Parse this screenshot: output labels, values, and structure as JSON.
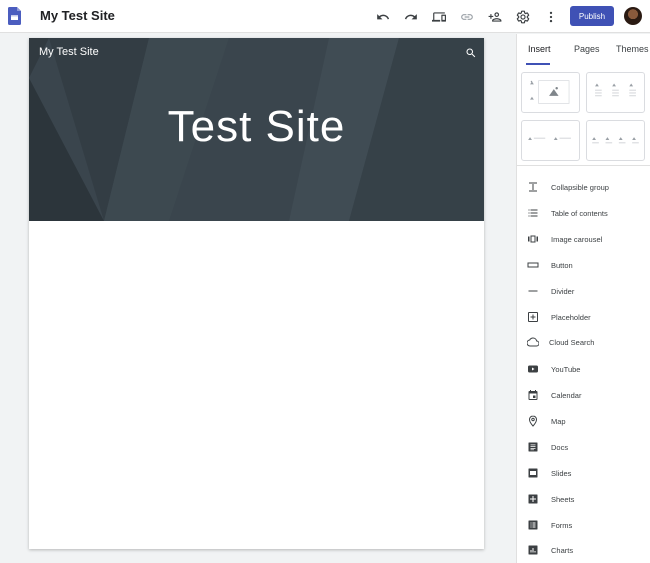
{
  "app": {
    "title": "My Test Site",
    "publish_label": "Publish"
  },
  "toolbar": {
    "icons": [
      "undo-icon",
      "redo-icon",
      "preview-icon",
      "link-icon",
      "share-icon",
      "settings-icon",
      "more-icon"
    ]
  },
  "site": {
    "header_name": "My Test Site",
    "hero_title": "Test Site"
  },
  "sidebar": {
    "tabs": [
      {
        "label": "Insert"
      },
      {
        "label": "Pages"
      },
      {
        "label": "Themes"
      }
    ],
    "items": [
      {
        "label": "Collapsible group",
        "icon": "collapsible-group-icon"
      },
      {
        "label": "Table of contents",
        "icon": "table-of-contents-icon"
      },
      {
        "label": "Image carousel",
        "icon": "image-carousel-icon"
      },
      {
        "label": "Button",
        "icon": "button-icon"
      },
      {
        "label": "Divider",
        "icon": "divider-icon"
      },
      {
        "label": "Placeholder",
        "icon": "placeholder-icon"
      },
      {
        "label": "Cloud Search",
        "icon": "cloud-search-icon"
      },
      {
        "label": "YouTube",
        "icon": "youtube-icon"
      },
      {
        "label": "Calendar",
        "icon": "calendar-icon"
      },
      {
        "label": "Map",
        "icon": "map-icon"
      },
      {
        "label": "Docs",
        "icon": "docs-icon"
      },
      {
        "label": "Slides",
        "icon": "slides-icon"
      },
      {
        "label": "Sheets",
        "icon": "sheets-icon"
      },
      {
        "label": "Forms",
        "icon": "forms-icon"
      },
      {
        "label": "Charts",
        "icon": "charts-icon"
      }
    ]
  },
  "colors": {
    "accent": "#3f51b5",
    "hero_bg": "#37424a",
    "app_logo": "#4b5dbf"
  }
}
